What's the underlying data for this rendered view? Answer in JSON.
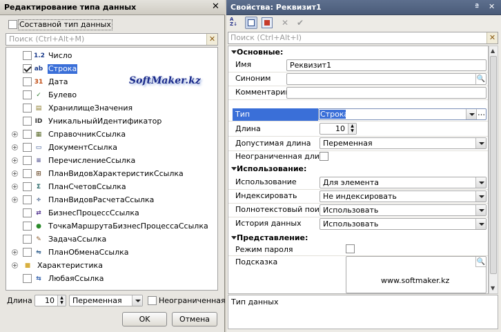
{
  "left": {
    "title": "Редактирование типа данных",
    "composite_label": "Составной тип данных",
    "search_placeholder": "Поиск (Ctrl+Alt+M)",
    "types": [
      {
        "label": "Число",
        "checked": false,
        "expandable": false,
        "icon": "number-icon"
      },
      {
        "label": "Строка",
        "checked": true,
        "expandable": false,
        "icon": "string-icon"
      },
      {
        "label": "Дата",
        "checked": false,
        "expandable": false,
        "icon": "calendar-icon"
      },
      {
        "label": "Булево",
        "checked": false,
        "expandable": false,
        "icon": "boolean-icon"
      },
      {
        "label": "ХранилищеЗначения",
        "checked": false,
        "expandable": false,
        "icon": "storage-icon"
      },
      {
        "label": "УникальныйИдентификатор",
        "checked": false,
        "expandable": false,
        "icon": "id-icon"
      },
      {
        "label": "СправочникСсылка",
        "checked": false,
        "expandable": true,
        "icon": "catalog-icon"
      },
      {
        "label": "ДокументСсылка",
        "checked": false,
        "expandable": true,
        "icon": "document-icon"
      },
      {
        "label": "ПеречислениеСсылка",
        "checked": false,
        "expandable": true,
        "icon": "enum-icon"
      },
      {
        "label": "ПланВидовХарактеристикСсылка",
        "checked": false,
        "expandable": true,
        "icon": "chart-of-characteristics-icon"
      },
      {
        "label": "ПланСчетовСсылка",
        "checked": false,
        "expandable": true,
        "icon": "chart-of-accounts-icon"
      },
      {
        "label": "ПланВидовРасчетаСсылка",
        "checked": false,
        "expandable": true,
        "icon": "calculation-types-icon"
      },
      {
        "label": "БизнесПроцессСсылка",
        "checked": false,
        "expandable": false,
        "icon": "business-process-icon"
      },
      {
        "label": "ТочкаМаршрутаБизнесПроцессаСсылка",
        "checked": false,
        "expandable": false,
        "icon": "route-point-icon"
      },
      {
        "label": "ЗадачаСсылка",
        "checked": false,
        "expandable": false,
        "icon": "task-icon"
      },
      {
        "label": "ПланОбменаСсылка",
        "checked": false,
        "expandable": true,
        "icon": "exchange-plan-icon"
      },
      {
        "label": "Характеристика",
        "checked": null,
        "expandable": true,
        "icon": "folder-icon"
      },
      {
        "label": "ЛюбаяСсылка",
        "checked": false,
        "expandable": false,
        "icon": "any-ref-icon"
      }
    ],
    "watermark": "SoftMaker.kz",
    "length_label": "Длина",
    "length_value": "10",
    "length_mode": "Переменная",
    "unlimited_label": "Неограниченная",
    "ok_label": "OK",
    "cancel_label": "Отмена"
  },
  "right": {
    "title": "Свойства: Реквизит1",
    "search_placeholder": "Поиск (Ctrl+Alt+I)",
    "section_main": "Основные:",
    "name_label": "Имя",
    "name_value": "Реквизит1",
    "synonym_label": "Синоним",
    "synonym_value": "",
    "comment_label": "Комментарий",
    "comment_value": "",
    "type_label": "Тип",
    "type_value": "Строка",
    "length_label": "Длина",
    "length_value": "10",
    "allowed_length_label": "Допустимая длина",
    "allowed_length_value": "Переменная",
    "unlimited_label": "Неограниченная длина",
    "section_usage": "Использование:",
    "usage_label": "Использование",
    "usage_value": "Для элемента",
    "index_label": "Индексировать",
    "index_value": "Не индексировать",
    "fulltext_label": "Полнотекстовый поиск",
    "fulltext_value": "Использовать",
    "history_label": "История данных",
    "history_value": "Использовать",
    "section_view": "Представление:",
    "password_label": "Режим пароля",
    "tooltip_label": "Подсказка",
    "tooltip_value": "www.softmaker.kz",
    "status": "Тип данных"
  },
  "colors": {
    "selection": "#3a6fd8",
    "watermark": "#1a2a8a"
  }
}
